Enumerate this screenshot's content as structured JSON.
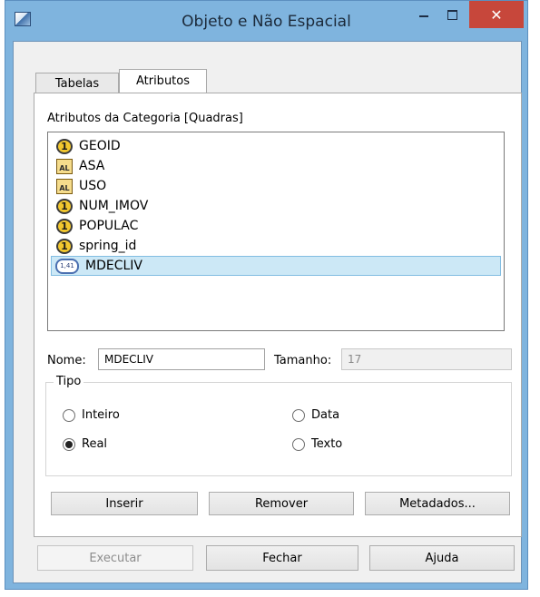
{
  "window": {
    "title": "Objeto e Não Espacial",
    "close_glyph": "✕"
  },
  "tabs": [
    {
      "label": "Tabelas",
      "active": false
    },
    {
      "label": "Atributos",
      "active": true
    }
  ],
  "attributes_panel": {
    "category_label": "Atributos da Categoria [Quadras]",
    "items": [
      {
        "name": "GEOID",
        "icon": "integer-attribute-icon",
        "icon_text": "1"
      },
      {
        "name": "ASA",
        "icon": "text-attribute-icon",
        "icon_text": "AL"
      },
      {
        "name": "USO",
        "icon": "text-attribute-icon",
        "icon_text": "AL"
      },
      {
        "name": "NUM_IMOV",
        "icon": "integer-attribute-icon",
        "icon_text": "1"
      },
      {
        "name": "POPULAC",
        "icon": "integer-attribute-icon",
        "icon_text": "1"
      },
      {
        "name": "spring_id",
        "icon": "integer-attribute-icon",
        "icon_text": "1"
      },
      {
        "name": "MDECLIV",
        "icon": "real-attribute-icon",
        "icon_text": "1,41",
        "selected": true
      }
    ],
    "nome_label": "Nome:",
    "nome_value": "MDECLIV",
    "tamanho_label": "Tamanho:",
    "tamanho_value": "17",
    "tipo": {
      "title": "Tipo",
      "options": [
        {
          "label": "Inteiro",
          "checked": false
        },
        {
          "label": "Data",
          "checked": false
        },
        {
          "label": "Real",
          "checked": true
        },
        {
          "label": "Texto",
          "checked": false
        }
      ]
    },
    "buttons": {
      "inserir": "Inserir",
      "remover": "Remover",
      "metadados": "Metadados..."
    }
  },
  "footer_buttons": {
    "executar": "Executar",
    "fechar": "Fechar",
    "ajuda": "Ajuda"
  }
}
